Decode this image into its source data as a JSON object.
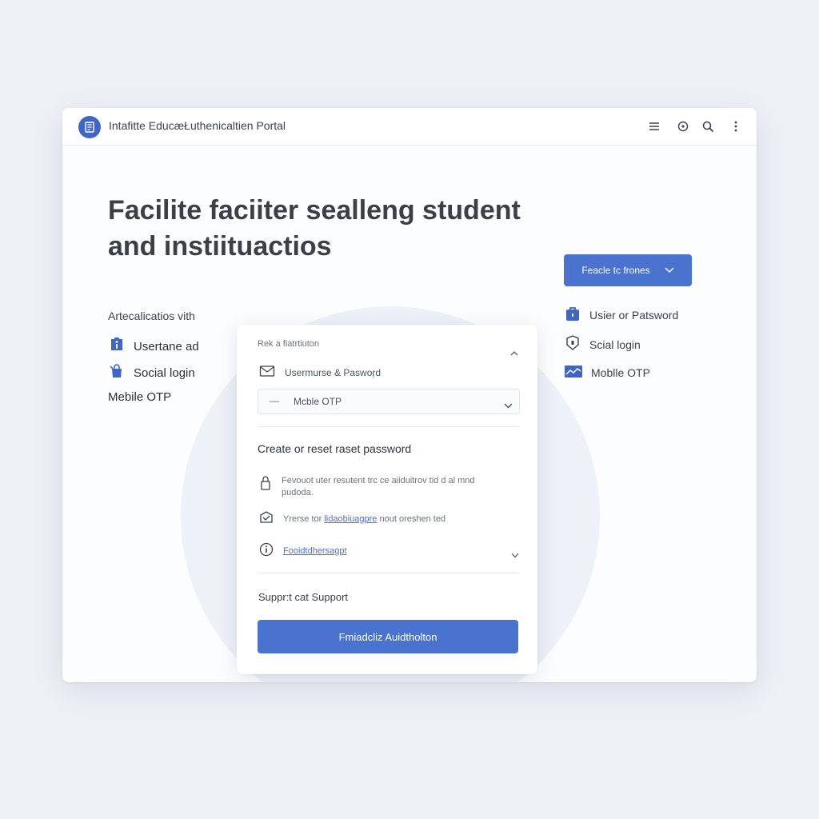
{
  "header": {
    "app_title": "Intafitte EducæŁuthenicaltien Portal",
    "icons": [
      "menu-icon",
      "help-icon",
      "search-icon",
      "more-vertical-icon"
    ]
  },
  "hero": {
    "line1": "Facilite faciiter sealleng student",
    "line2": "and instiituactios"
  },
  "left_panel": {
    "heading": "Artecalicatios vith",
    "items": [
      "Usertane ad",
      "Social login",
      "Mebile OTP"
    ]
  },
  "right_panel": {
    "button_label": "Feacle tc frones",
    "items": [
      "Usier or Patsword",
      "Scial login",
      "Moblle OTP"
    ]
  },
  "card": {
    "section_label": "Rek a fiatrtiuton",
    "username_label": "Usermurse & Paswoŗd",
    "select_value": "Mcble OTP",
    "reset_title": "Create or reset raset password",
    "info1": "Fevouot uter resutent trc ce aiiduitrov tid d al mnd pudoda.",
    "info2_prefix": "Yrerse tor",
    "info2_link": "lidaobiuagpre",
    "info2_suffix": "nout oreshen ted",
    "info3_link": "Fooidtdhersagpt",
    "support_label": "Suppr:t cat Support",
    "primary_button": "Fmiadcliz Auidtholton"
  },
  "colors": {
    "accent": "#4a72cf",
    "background": "#eef1f6"
  }
}
